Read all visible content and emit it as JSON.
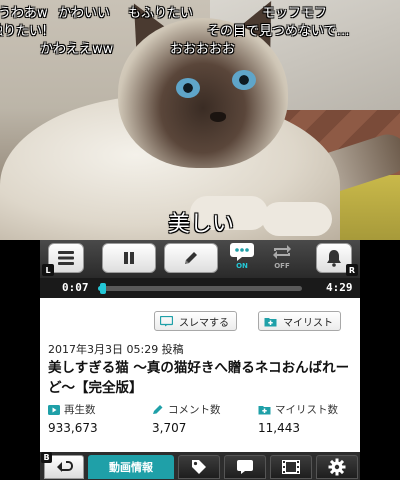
{
  "comments": [
    {
      "text": "うわあw"
    },
    {
      "text": "かわいい"
    },
    {
      "text": "もふりたい"
    },
    {
      "text": "モッフモフ"
    },
    {
      "text": "触りたい!"
    },
    {
      "text": "その目で見つめないで…"
    },
    {
      "text": "かわええww"
    },
    {
      "text": "おおおおお"
    },
    {
      "text": "美しい"
    }
  ],
  "controls": {
    "shoulder_left": "L",
    "shoulder_right": "R",
    "comment_toggle_state": "ON",
    "repeat_toggle_state": "OFF"
  },
  "seek": {
    "current": "0:07",
    "total": "4:29",
    "progress": 0.026
  },
  "actions": {
    "slema": "スレマする",
    "mylist": "マイリスト"
  },
  "video": {
    "posted": "2017年3月3日 05:29 投稿",
    "title": "美しすぎる猫 ～真の猫好きへ贈るネコおんばれーど～【完全版】",
    "stats": {
      "views_label": "再生数",
      "views": "933,673",
      "comments_label": "コメント数",
      "comments": "3,707",
      "mylist_label": "マイリスト数",
      "mylist": "11,443"
    }
  },
  "tabs": {
    "back_key": "B",
    "info_label": "動画情報"
  },
  "colors": {
    "accent": "#1fa0a8",
    "seek": "#23c7d6"
  }
}
